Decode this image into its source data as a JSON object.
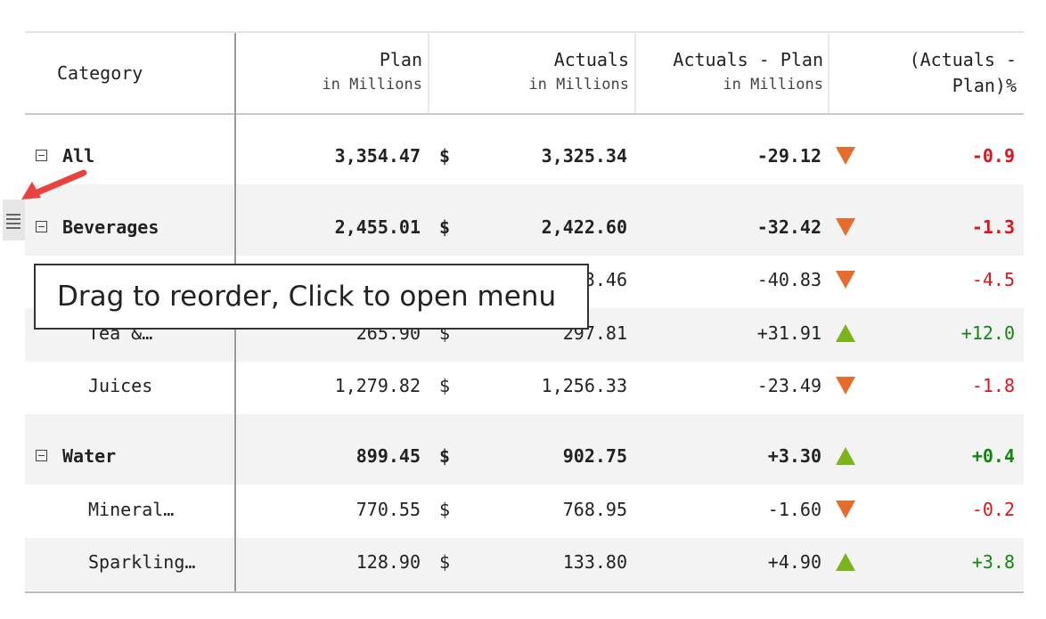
{
  "columns": {
    "category": "Category",
    "plan": {
      "title": "Plan",
      "sub": "in Millions"
    },
    "actuals": {
      "title": "Actuals",
      "sub": "in Millions"
    },
    "diff": {
      "title": "Actuals - Plan",
      "sub": "in Millions"
    },
    "pct": {
      "title1": "(Actuals -",
      "title2": "Plan)%"
    }
  },
  "rows": [
    {
      "label": "All",
      "plan": "3,354.47",
      "currency": "$",
      "actuals": "3,325.34",
      "diff": "-29.12",
      "trend": "down",
      "pct": "-0.9"
    },
    {
      "label": "Beverages",
      "plan": "2,455.01",
      "currency": "$",
      "actuals": "2,422.60",
      "diff": "-32.42",
      "trend": "down",
      "pct": "-1.3"
    },
    {
      "label": "",
      "plan": "",
      "currency": "",
      "actuals": "3.46",
      "diff": "-40.83",
      "trend": "down",
      "pct": "-4.5"
    },
    {
      "label": "Tea &…",
      "plan": "265.90",
      "currency": "$",
      "actuals": "297.81",
      "diff": "+31.91",
      "trend": "up",
      "pct": "+12.0"
    },
    {
      "label": "Juices",
      "plan": "1,279.82",
      "currency": "$",
      "actuals": "1,256.33",
      "diff": "-23.49",
      "trend": "down",
      "pct": "-1.8"
    },
    {
      "label": "Water",
      "plan": "899.45",
      "currency": "$",
      "actuals": "902.75",
      "diff": "+3.30",
      "trend": "up",
      "pct": "+0.4"
    },
    {
      "label": "Mineral…",
      "plan": "770.55",
      "currency": "$",
      "actuals": "768.95",
      "diff": "-1.60",
      "trend": "down",
      "pct": "-0.2"
    },
    {
      "label": "Sparkling…",
      "plan": "128.90",
      "currency": "$",
      "actuals": "133.80",
      "diff": "+4.90",
      "trend": "up",
      "pct": "+3.8"
    }
  ],
  "tooltip": "Drag to reorder, Click to open menu",
  "icons": {
    "handle": "drag-handle-icon",
    "expand": "collapse-icon",
    "down": "triangle-down-icon",
    "up": "triangle-up-icon"
  },
  "colors": {
    "negative": "#e0131c",
    "positive": "#12870f",
    "down_marker": "#e86b2e",
    "up_marker": "#7bb31a"
  }
}
